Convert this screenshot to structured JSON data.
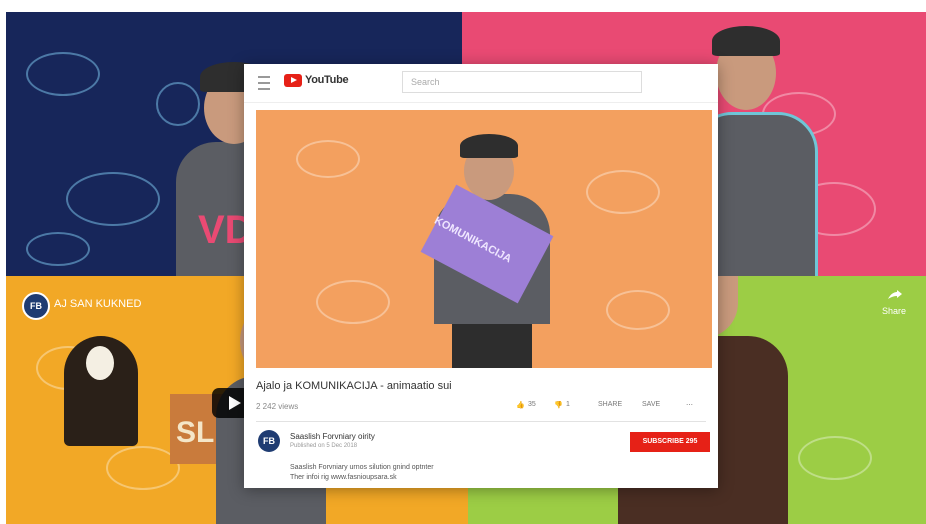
{
  "header": {
    "logo_text": "YouTube",
    "search_placeholder": "Search"
  },
  "sign": {
    "vd": "VD",
    "kom": "KOMUNIKACIJA",
    "sl": "SLI"
  },
  "video": {
    "title": "Ajalo ja KOMUNIKACIJA - animaatio sui",
    "views": "2 242 views",
    "actions": {
      "like": "35",
      "dislike": "1",
      "share": "SHARE",
      "save": "SAVE"
    }
  },
  "channel": {
    "initials": "FB",
    "name": "Saaslish Forvniary oirity",
    "published": "Published on 5 Dec 2018",
    "subscribe": "SUBSCRIBE 295",
    "desc_line1": "Saaslish Forvniary urnos silution gnind optnter",
    "desc_line2": "Ther infoi rig www.fasnioupsara.sk"
  },
  "overlay": {
    "title": "AJ SAN KUKNED",
    "share": "Share"
  },
  "colors": {
    "navy": "#17265a",
    "pink": "#e94a73",
    "orange": "#f3a05f",
    "yellow": "#f2a826",
    "green": "#9ccd45",
    "youtube_red": "#e62117"
  }
}
